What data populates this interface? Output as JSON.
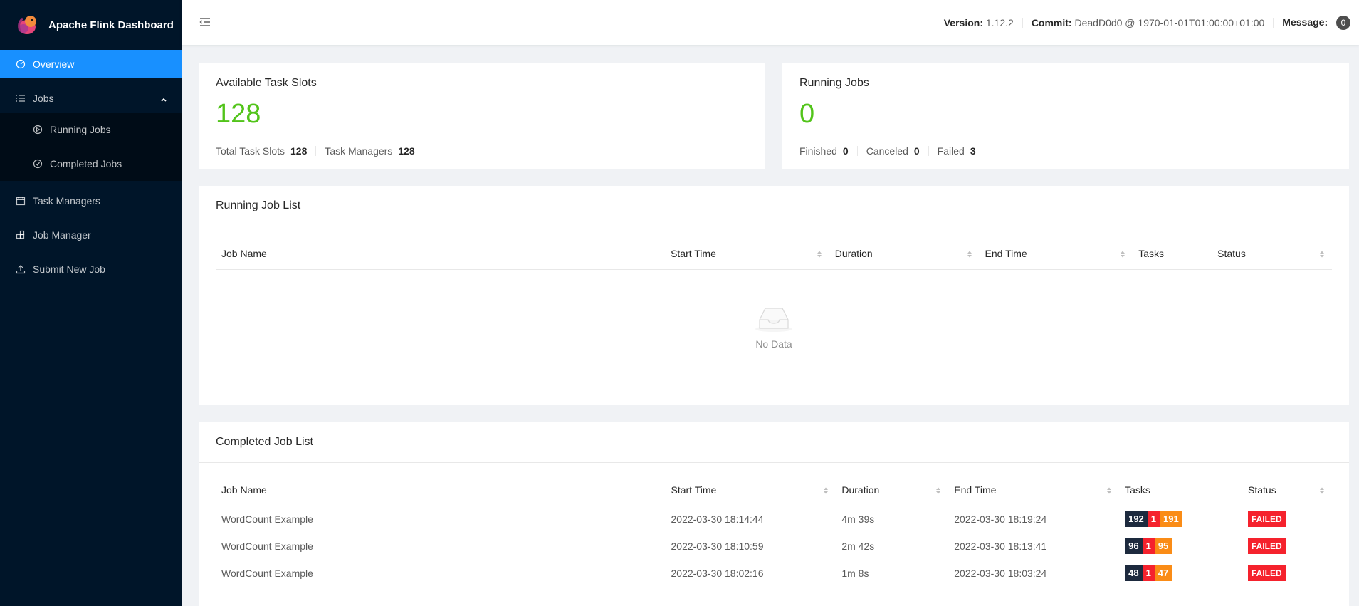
{
  "brand": {
    "title": "Apache Flink Dashboard"
  },
  "sidebar": {
    "items": [
      {
        "label": "Overview",
        "icon": "dashboard-icon"
      },
      {
        "label": "Jobs",
        "icon": "bars-icon"
      },
      {
        "label": "Running Jobs",
        "icon": "play-circle-icon"
      },
      {
        "label": "Completed Jobs",
        "icon": "check-circle-icon"
      },
      {
        "label": "Task Managers",
        "icon": "schedule-icon"
      },
      {
        "label": "Job Manager",
        "icon": "build-icon"
      },
      {
        "label": "Submit New Job",
        "icon": "upload-icon"
      }
    ]
  },
  "header": {
    "version_label": "Version:",
    "version_value": "1.12.2",
    "commit_label": "Commit:",
    "commit_value": "DeadD0d0 @ 1970-01-01T01:00:00+01:00",
    "message_label": "Message:",
    "message_count": "0"
  },
  "slots": {
    "title": "Available Task Slots",
    "value": "128",
    "total_label": "Total Task Slots",
    "total_value": "128",
    "tm_label": "Task Managers",
    "tm_value": "128"
  },
  "running": {
    "title": "Running Jobs",
    "value": "0",
    "finished_label": "Finished",
    "finished_value": "0",
    "canceled_label": "Canceled",
    "canceled_value": "0",
    "failed_label": "Failed",
    "failed_value": "3"
  },
  "running_list": {
    "title": "Running Job List",
    "columns": [
      "Job Name",
      "Start Time",
      "Duration",
      "End Time",
      "Tasks",
      "Status"
    ],
    "empty_text": "No Data"
  },
  "completed_list": {
    "title": "Completed Job List",
    "columns": [
      "Job Name",
      "Start Time",
      "Duration",
      "End Time",
      "Tasks",
      "Status"
    ],
    "rows": [
      {
        "name": "WordCount Example",
        "start": "2022-03-30 18:14:44",
        "duration": "4m 39s",
        "end": "2022-03-30 18:19:24",
        "tasks_total": "192",
        "tasks_failed": "1",
        "tasks_canceled": "191",
        "status": "FAILED"
      },
      {
        "name": "WordCount Example",
        "start": "2022-03-30 18:10:59",
        "duration": "2m 42s",
        "end": "2022-03-30 18:13:41",
        "tasks_total": "96",
        "tasks_failed": "1",
        "tasks_canceled": "95",
        "status": "FAILED"
      },
      {
        "name": "WordCount Example",
        "start": "2022-03-30 18:02:16",
        "duration": "1m 8s",
        "end": "2022-03-30 18:03:24",
        "tasks_total": "48",
        "tasks_failed": "1",
        "tasks_canceled": "47",
        "status": "FAILED"
      }
    ]
  }
}
